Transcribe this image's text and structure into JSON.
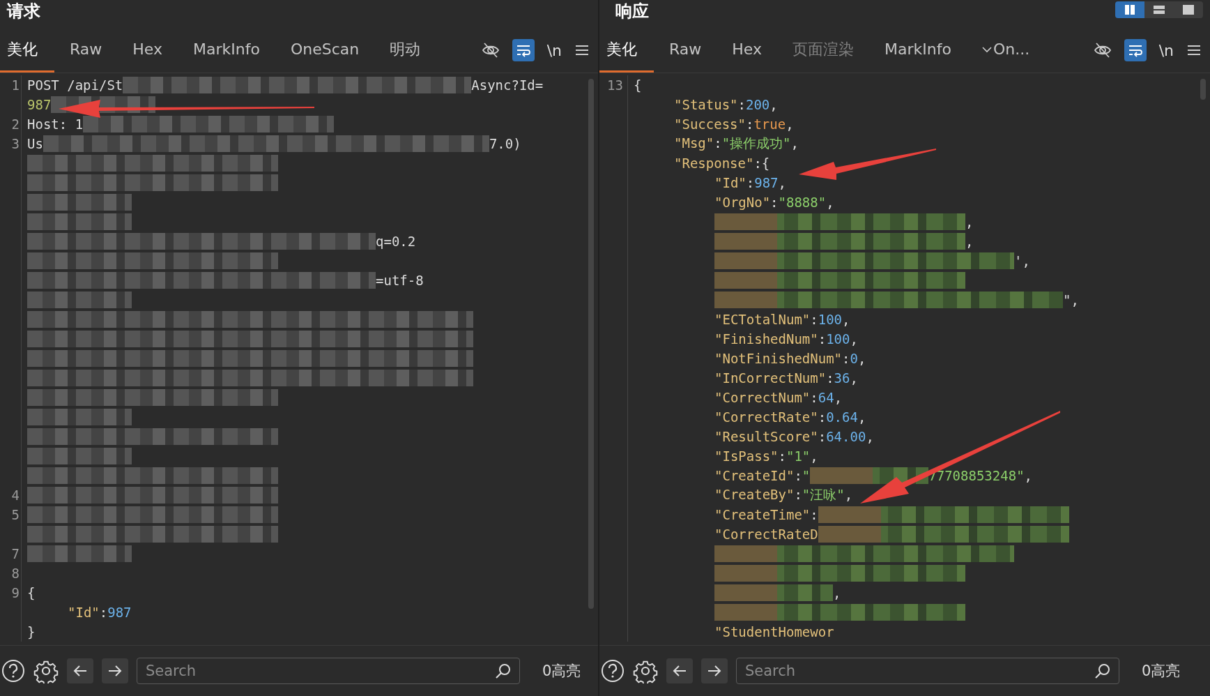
{
  "layout_buttons": [
    {
      "kind": "columns",
      "selected": true
    },
    {
      "kind": "rows",
      "selected": false
    },
    {
      "kind": "single",
      "selected": false
    }
  ],
  "panes": [
    {
      "title": "请求",
      "tabs": [
        {
          "label": "美化",
          "selected": true,
          "disabled": false,
          "dropdown": false
        },
        {
          "label": "Raw",
          "selected": false,
          "disabled": false,
          "dropdown": false
        },
        {
          "label": "Hex",
          "selected": false,
          "disabled": false,
          "dropdown": false
        },
        {
          "label": "MarkInfo",
          "selected": false,
          "disabled": false,
          "dropdown": false
        },
        {
          "label": "OneScan",
          "selected": false,
          "disabled": false,
          "dropdown": false
        },
        {
          "label": "明动",
          "selected": false,
          "disabled": false,
          "dropdown": false
        }
      ],
      "toolbar": {
        "wrap_selected": true,
        "newline_label": "\\n"
      },
      "lines": [
        {
          "number": "1",
          "segments": [
            {
              "kind": "plain",
              "text": "POST /api/St"
            },
            {
              "kind": "blurlong"
            },
            {
              "kind": "plain",
              "text": "Async?Id="
            }
          ]
        },
        {
          "segments": [
            {
              "kind": "param",
              "text": "987"
            },
            {
              "kind": "blurshort"
            }
          ]
        },
        {
          "number": "2",
          "segments": [
            {
              "kind": "plain",
              "text": "Host: 1"
            },
            {
              "kind": "blurmedium"
            }
          ]
        },
        {
          "number": "3",
          "segments": [
            {
              "kind": "plain",
              "text": "Us"
            },
            {
              "kind": "blurfull"
            },
            {
              "kind": "plain",
              "text": "7.0)"
            }
          ]
        },
        {
          "segments": [
            {
              "kind": "blurmedium"
            }
          ]
        },
        {
          "segments": [
            {
              "kind": "blurmedium"
            }
          ]
        },
        {
          "segments": [
            {
              "kind": "blurshort"
            }
          ]
        },
        {
          "segments": [
            {
              "kind": "blurshort"
            }
          ]
        },
        {
          "segments": [
            {
              "kind": "blurlong"
            },
            {
              "kind": "plain",
              "text": "q=0.2"
            }
          ]
        },
        {
          "segments": [
            {
              "kind": "blurmedium"
            }
          ]
        },
        {
          "segments": [
            {
              "kind": "blurlong"
            },
            {
              "kind": "plain",
              "text": "=utf-8"
            }
          ]
        },
        {
          "segments": [
            {
              "kind": "blurshort"
            }
          ]
        },
        {
          "segments": [
            {
              "kind": "blurfull"
            }
          ]
        },
        {
          "segments": [
            {
              "kind": "blurfull"
            }
          ]
        },
        {
          "segments": [
            {
              "kind": "blurfull"
            }
          ]
        },
        {
          "segments": [
            {
              "kind": "blurfull"
            }
          ]
        },
        {
          "segments": [
            {
              "kind": "blurmedium"
            }
          ]
        },
        {
          "segments": [
            {
              "kind": "blurshort"
            }
          ]
        },
        {
          "segments": [
            {
              "kind": "blurmedium"
            }
          ]
        },
        {
          "segments": [
            {
              "kind": "blurshort"
            }
          ]
        },
        {
          "segments": [
            {
              "kind": "blurmedium"
            }
          ]
        },
        {
          "number": "4",
          "segments": [
            {
              "kind": "blurmedium"
            }
          ]
        },
        {
          "number": "5",
          "segments": [
            {
              "kind": "blurmedium"
            }
          ]
        },
        {
          "segments": [
            {
              "kind": "blurmedium"
            }
          ]
        },
        {
          "number": "7",
          "segments": [
            {
              "kind": "blurshort"
            }
          ]
        },
        {
          "number": "8"
        },
        {
          "number": "9",
          "segments": [
            {
              "kind": "punct",
              "text": "{"
            }
          ],
          "children": [
            {
              "segments": [
                {
                  "kind": "key",
                  "text": "\"Id\""
                },
                {
                  "kind": "punct",
                  "text": ":"
                },
                {
                  "kind": "num",
                  "text": "987"
                }
              ]
            }
          ]
        },
        {
          "segments": [
            {
              "kind": "punct",
              "text": "}"
            }
          ]
        }
      ],
      "search_placeholder": "Search",
      "highlight_count": "0高亮"
    },
    {
      "title": "响应",
      "tabs": [
        {
          "label": "美化",
          "selected": true,
          "disabled": false,
          "dropdown": false
        },
        {
          "label": "Raw",
          "selected": false,
          "disabled": false,
          "dropdown": false
        },
        {
          "label": "Hex",
          "selected": false,
          "disabled": false,
          "dropdown": false
        },
        {
          "label": "页面渲染",
          "selected": false,
          "disabled": true,
          "dropdown": false
        },
        {
          "label": "MarkInfo",
          "selected": false,
          "disabled": false,
          "dropdown": false
        },
        {
          "label": "On...",
          "selected": false,
          "disabled": false,
          "dropdown": true
        }
      ],
      "toolbar": {
        "wrap_selected": true,
        "newline_label": "\\n"
      },
      "lines": [
        {
          "number": "13",
          "segments": [
            {
              "kind": "punct",
              "text": "{"
            }
          ],
          "children": [
            {
              "segments": [
                {
                  "kind": "key",
                  "text": "\"Status\""
                },
                {
                  "kind": "punct",
                  "text": ":"
                },
                {
                  "kind": "num",
                  "text": "200"
                },
                {
                  "kind": "punct",
                  "text": ","
                }
              ]
            },
            {
              "segments": [
                {
                  "kind": "key",
                  "text": "\"Success\""
                },
                {
                  "kind": "punct",
                  "text": ":"
                },
                {
                  "kind": "bool",
                  "text": "true"
                },
                {
                  "kind": "punct",
                  "text": ","
                }
              ]
            },
            {
              "segments": [
                {
                  "kind": "key",
                  "text": "\"Msg\""
                },
                {
                  "kind": "punct",
                  "text": ":"
                },
                {
                  "kind": "str",
                  "text": "\"操作成功\""
                },
                {
                  "kind": "punct",
                  "text": ","
                }
              ]
            },
            {
              "segments": [
                {
                  "kind": "key",
                  "text": "\"Response\""
                },
                {
                  "kind": "punct",
                  "text": ":{"
                }
              ],
              "children": [
                {
                  "segments": [
                    {
                      "kind": "key",
                      "text": "\"Id\""
                    },
                    {
                      "kind": "punct",
                      "text": ":"
                    },
                    {
                      "kind": "num",
                      "text": "987"
                    },
                    {
                      "kind": "punct",
                      "text": ","
                    }
                  ]
                },
                {
                  "segments": [
                    {
                      "kind": "key",
                      "text": "\"OrgNo\""
                    },
                    {
                      "kind": "punct",
                      "text": ":"
                    },
                    {
                      "kind": "str",
                      "text": "\"8888\""
                    },
                    {
                      "kind": "punct",
                      "text": ","
                    }
                  ]
                },
                {
                  "segments": [
                    {
                      "kind": "blurmedium"
                    },
                    {
                      "kind": "punct",
                      "text": ","
                    }
                  ]
                },
                {
                  "segments": [
                    {
                      "kind": "blurmedium"
                    },
                    {
                      "kind": "punct",
                      "text": ","
                    }
                  ]
                },
                {
                  "segments": [
                    {
                      "kind": "blurlong"
                    },
                    {
                      "kind": "punct",
                      "text": "',"
                    }
                  ]
                },
                {
                  "segments": [
                    {
                      "kind": "blurmedium"
                    }
                  ]
                },
                {
                  "segments": [
                    {
                      "kind": "blurfull"
                    },
                    {
                      "kind": "punct",
                      "text": "\","
                    }
                  ]
                },
                {
                  "segments": [
                    {
                      "kind": "key",
                      "text": "\"ECTotalNum\""
                    },
                    {
                      "kind": "punct",
                      "text": ":"
                    },
                    {
                      "kind": "num",
                      "text": "100"
                    },
                    {
                      "kind": "punct",
                      "text": ","
                    }
                  ]
                },
                {
                  "segments": [
                    {
                      "kind": "key",
                      "text": "\"FinishedNum\""
                    },
                    {
                      "kind": "punct",
                      "text": ":"
                    },
                    {
                      "kind": "num",
                      "text": "100"
                    },
                    {
                      "kind": "punct",
                      "text": ","
                    }
                  ]
                },
                {
                  "segments": [
                    {
                      "kind": "key",
                      "text": "\"NotFinishedNum\""
                    },
                    {
                      "kind": "punct",
                      "text": ":"
                    },
                    {
                      "kind": "num",
                      "text": "0"
                    },
                    {
                      "kind": "punct",
                      "text": ","
                    }
                  ]
                },
                {
                  "segments": [
                    {
                      "kind": "key",
                      "text": "\"InCorrectNum\""
                    },
                    {
                      "kind": "punct",
                      "text": ":"
                    },
                    {
                      "kind": "num",
                      "text": "36"
                    },
                    {
                      "kind": "punct",
                      "text": ","
                    }
                  ]
                },
                {
                  "segments": [
                    {
                      "kind": "key",
                      "text": "\"CorrectNum\""
                    },
                    {
                      "kind": "punct",
                      "text": ":"
                    },
                    {
                      "kind": "num",
                      "text": "64"
                    },
                    {
                      "kind": "punct",
                      "text": ","
                    }
                  ]
                },
                {
                  "segments": [
                    {
                      "kind": "key",
                      "text": "\"CorrectRate\""
                    },
                    {
                      "kind": "punct",
                      "text": ":"
                    },
                    {
                      "kind": "num",
                      "text": "0.64"
                    },
                    {
                      "kind": "punct",
                      "text": ","
                    }
                  ]
                },
                {
                  "segments": [
                    {
                      "kind": "key",
                      "text": "\"ResultScore\""
                    },
                    {
                      "kind": "punct",
                      "text": ":"
                    },
                    {
                      "kind": "num",
                      "text": "64.00"
                    },
                    {
                      "kind": "punct",
                      "text": ","
                    }
                  ]
                },
                {
                  "segments": [
                    {
                      "kind": "key",
                      "text": "\"IsPass\""
                    },
                    {
                      "kind": "punct",
                      "text": ":"
                    },
                    {
                      "kind": "str",
                      "text": "\"1\""
                    },
                    {
                      "kind": "punct",
                      "text": ","
                    }
                  ]
                },
                {
                  "segments": [
                    {
                      "kind": "key",
                      "text": "\"CreateId\""
                    },
                    {
                      "kind": "punct",
                      "text": ":"
                    },
                    {
                      "kind": "str",
                      "text": "\""
                    },
                    {
                      "kind": "blurshort"
                    },
                    {
                      "kind": "str",
                      "text": "77708853248\""
                    },
                    {
                      "kind": "punct",
                      "text": ","
                    }
                  ]
                },
                {
                  "segments": [
                    {
                      "kind": "key",
                      "text": "\"CreateBy\""
                    },
                    {
                      "kind": "punct",
                      "text": ":"
                    },
                    {
                      "kind": "str",
                      "text": "\"汪咏\""
                    },
                    {
                      "kind": "punct",
                      "text": ","
                    }
                  ]
                },
                {
                  "segments": [
                    {
                      "kind": "key",
                      "text": "\"CreateTime\""
                    },
                    {
                      "kind": "punct",
                      "text": ":"
                    },
                    {
                      "kind": "blurmedium"
                    }
                  ]
                },
                {
                  "segments": [
                    {
                      "kind": "key",
                      "text": "\"CorrectRateD"
                    },
                    {
                      "kind": "blurmedium"
                    }
                  ]
                },
                {
                  "segments": [
                    {
                      "kind": "blurlong"
                    }
                  ]
                },
                {
                  "segments": [
                    {
                      "kind": "blurmedium"
                    }
                  ]
                },
                {
                  "segments": [
                    {
                      "kind": "blurshort"
                    },
                    {
                      "kind": "punct",
                      "text": ","
                    }
                  ]
                },
                {
                  "segments": [
                    {
                      "kind": "blurmedium"
                    }
                  ]
                },
                {
                  "segments": [
                    {
                      "kind": "key",
                      "text": "\"StudentHomewor"
                    }
                  ]
                }
              ]
            }
          ]
        }
      ],
      "search_placeholder": "Search",
      "highlight_count": "0高亮"
    }
  ]
}
